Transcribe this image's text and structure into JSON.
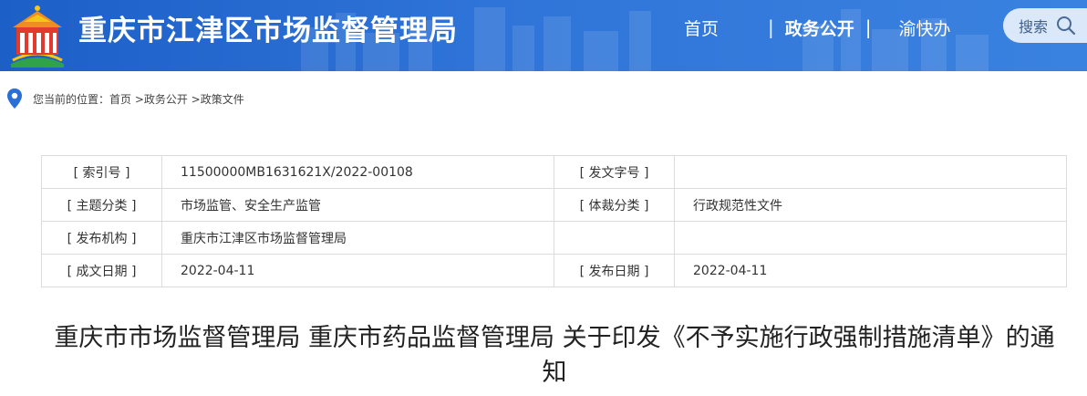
{
  "header": {
    "site_title": "重庆市江津区市场监督管理局",
    "nav": {
      "home": "首页",
      "sep1": "|",
      "gov": "政务公开",
      "sep2": "|",
      "service": "渝快办"
    },
    "search_label": "搜索",
    "colors": {
      "header_bg": "#2a6fd6",
      "text": "#ffffff"
    }
  },
  "breadcrumb": {
    "text": "您当前的位置：首页 >政务公开 >政策文件"
  },
  "info_table": {
    "rows": [
      {
        "k1": "[ 索引号 ]",
        "v1": "11500000MB1631621X/2022-00108",
        "k2": "[ 发文字号 ]",
        "v2": ""
      },
      {
        "k1": "[ 主题分类 ]",
        "v1": "市场监管、安全生产监管",
        "k2": "[ 体裁分类 ]",
        "v2": "行政规范性文件"
      },
      {
        "k1": "[ 发布机构 ]",
        "v1": "重庆市江津区市场监督管理局",
        "k2": "",
        "v2": ""
      },
      {
        "k1": "[ 成文日期 ]",
        "v1": "2022-04-11",
        "k2": "[ 发布日期 ]",
        "v2": "2022-04-11"
      }
    ]
  },
  "document": {
    "title": "重庆市市场监督管理局 重庆市药品监督管理局 关于印发《不予实施行政强制措施清单》的通知"
  }
}
